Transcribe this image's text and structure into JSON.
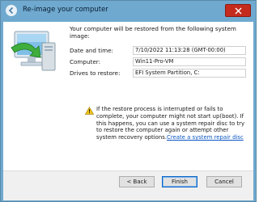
{
  "window": {
    "title": "Re-image your computer"
  },
  "intro_text": "Your computer will be restored from the following system image:",
  "details": [
    {
      "label": "Date and time:",
      "value": "7/10/2022 11:13:28 (GMT-00:00)"
    },
    {
      "label": "Computer:",
      "value": "Win11-Pro-VM"
    },
    {
      "label": "Drives to restore:",
      "value": "EFI System Partition, C:"
    }
  ],
  "warning": {
    "text": "If the restore process is interrupted or fails to complete, your computer might not start up(boot). If this happens, you can use a system repair disc to try to restore the computer again or attempt other system recovery options.",
    "link": "Create a system repair disc"
  },
  "buttons": {
    "back": "< Back",
    "finish": "Finish",
    "cancel": "Cancel"
  },
  "icons": {
    "title_back": "back-arrow-icon",
    "close": "close-icon",
    "logo": "restore-computer-icon",
    "warning": "warning-icon"
  },
  "colors": {
    "titlebar": "#6fa9cf",
    "close": "#c42b1c",
    "link": "#0b57c2"
  }
}
